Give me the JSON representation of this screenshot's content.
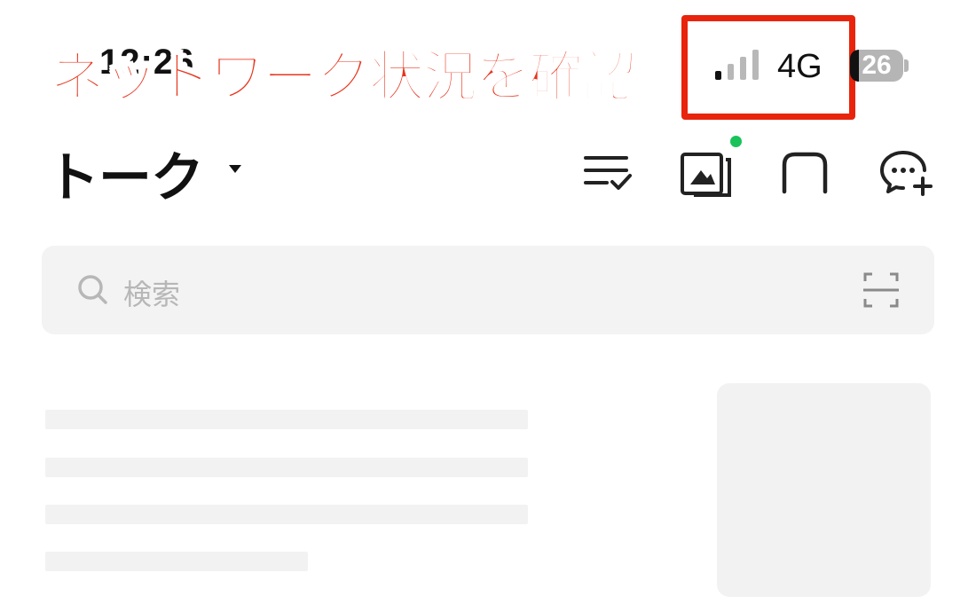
{
  "status_bar": {
    "time": "12:26",
    "network_type": "4G",
    "battery_level": "26",
    "signal_bars_active": 1,
    "signal_bars_total": 4
  },
  "annotation": {
    "callout_text": "ネットワーク状況を確認",
    "callout_color": "#e8341c",
    "box_color": "#e8240c"
  },
  "header": {
    "title": "トーク",
    "icons": [
      "sort-check-icon",
      "album-icon",
      "square-chat-icon",
      "new-chat-icon"
    ],
    "album_badge_color": "#19c35a"
  },
  "search": {
    "placeholder": "検索"
  }
}
